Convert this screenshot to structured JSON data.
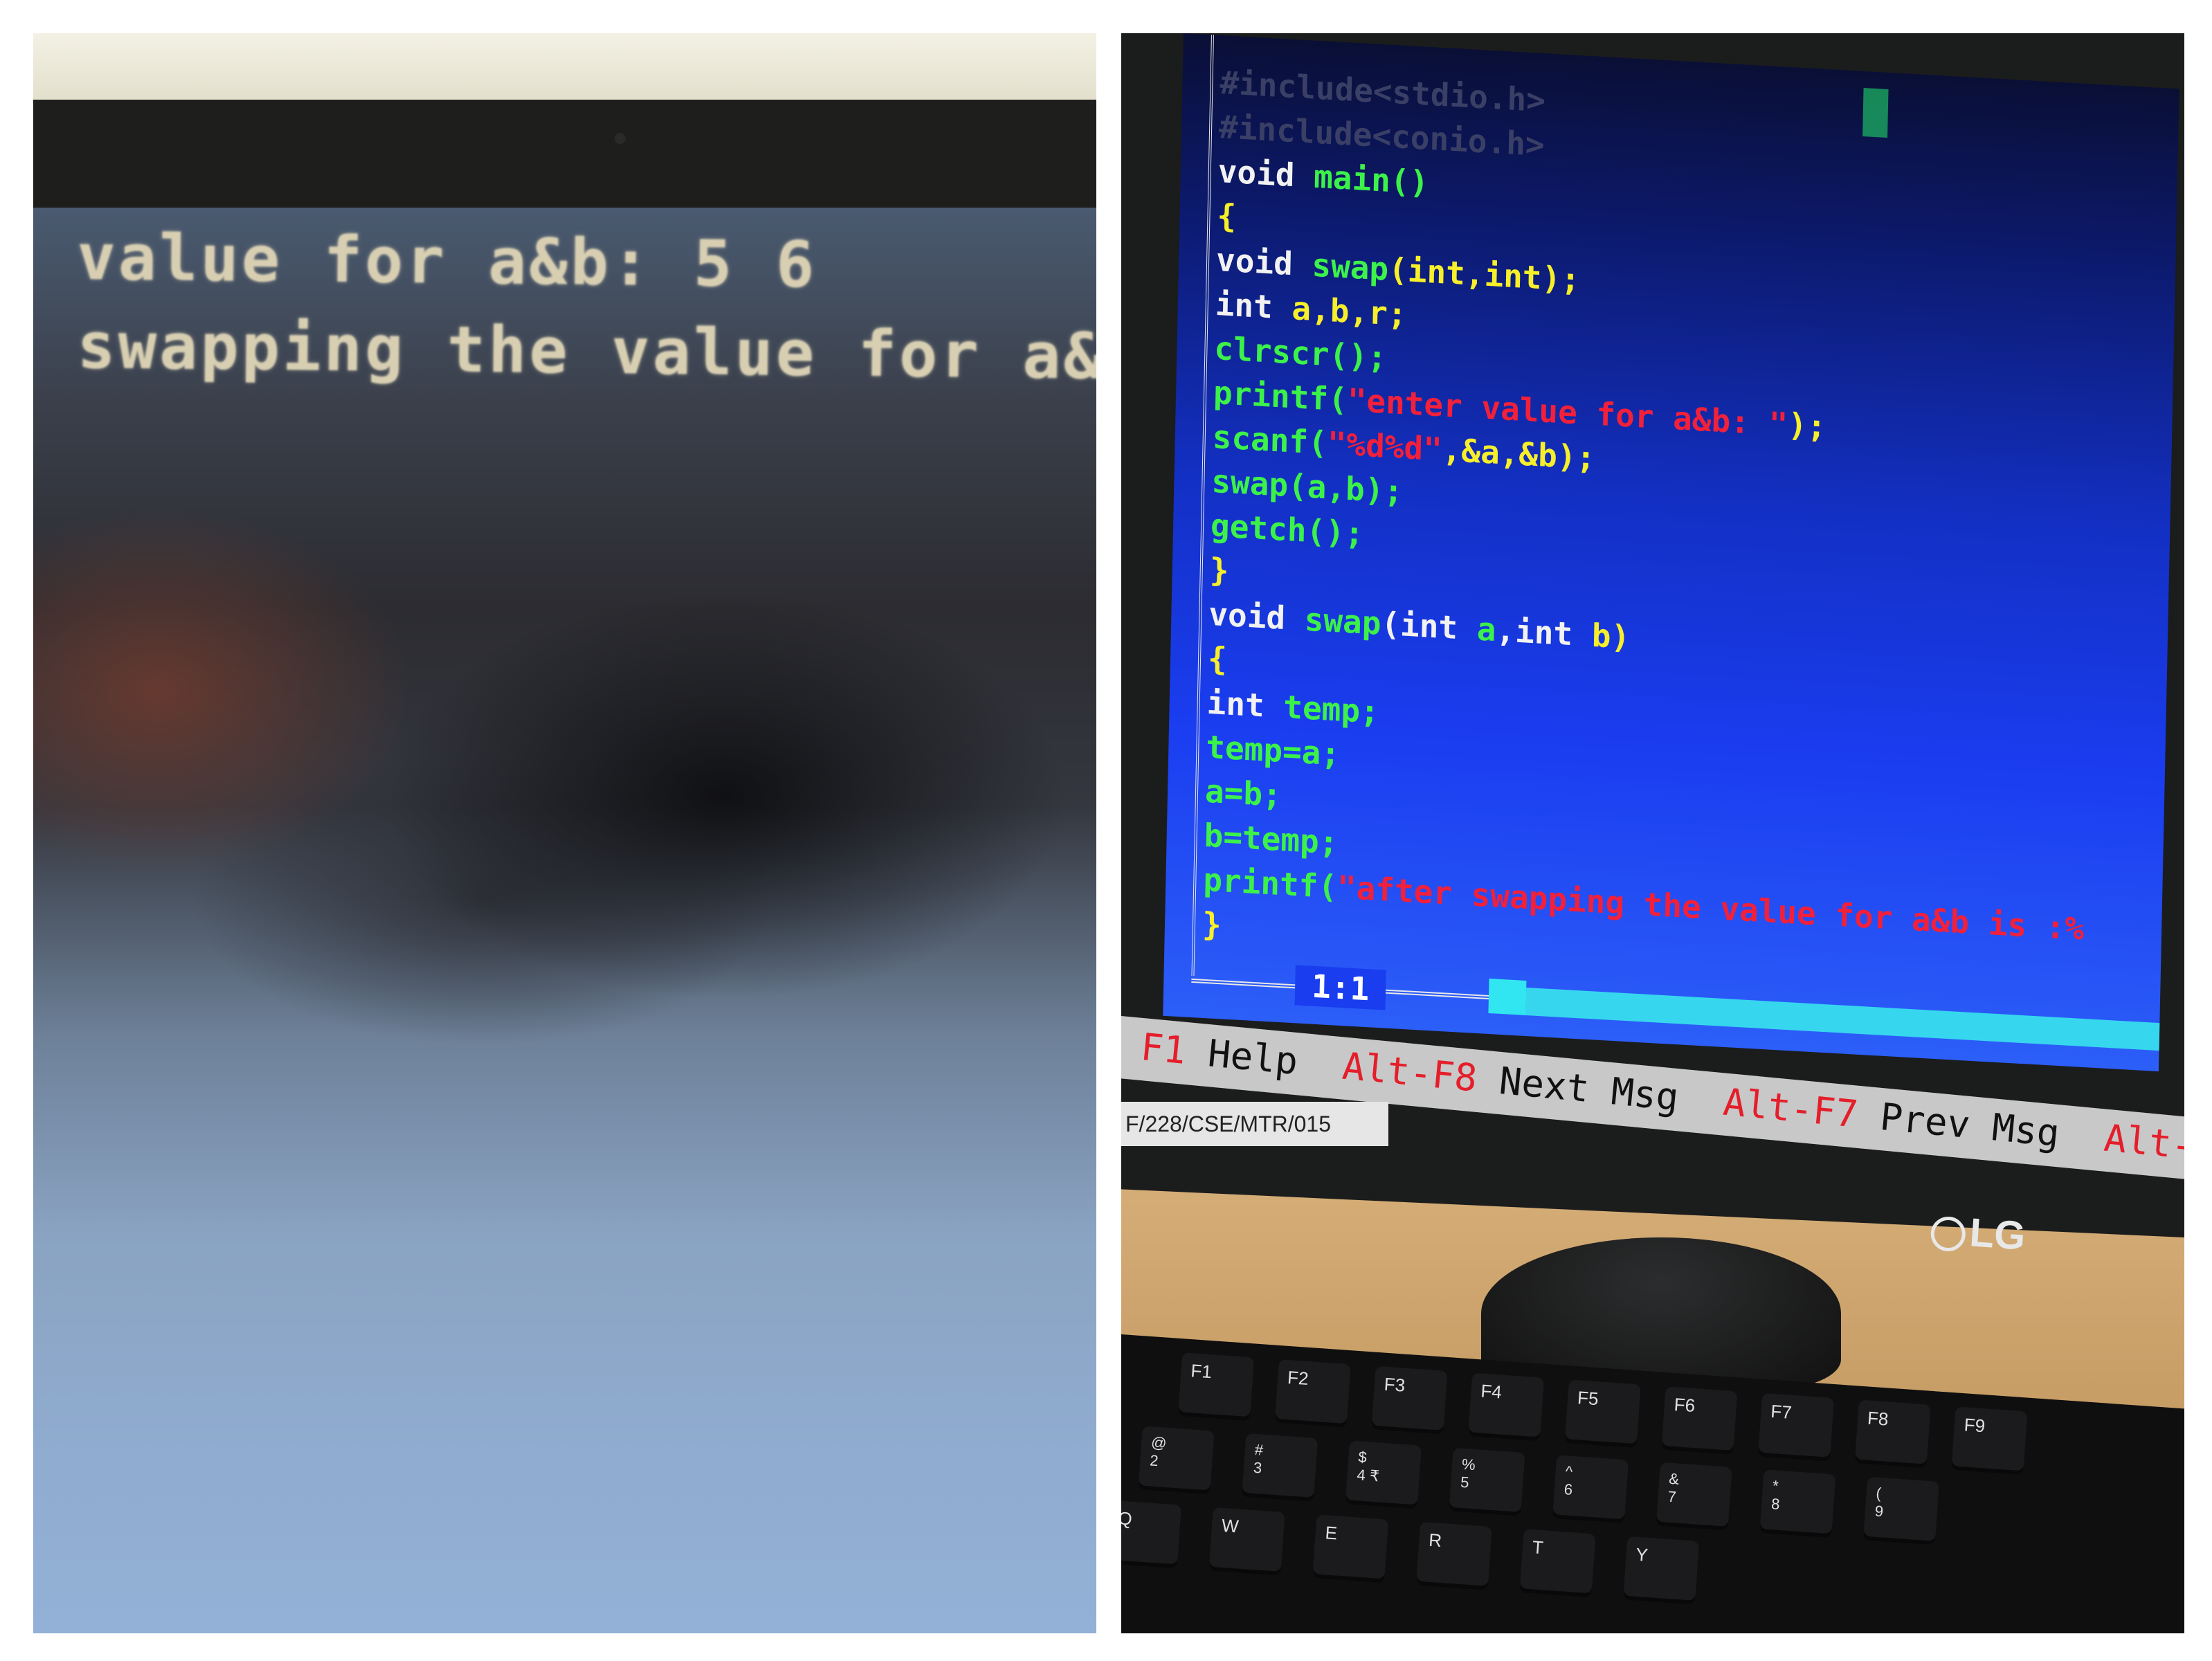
{
  "left_panel": {
    "output_lines": [
      "value for a&b: 5 6",
      "swapping the value for a&"
    ]
  },
  "right_panel": {
    "code_lines": [
      [
        {
          "t": "#include<stdio.h>",
          "c": "dim"
        }
      ],
      [
        {
          "t": "#include<conio.h>",
          "c": "dim"
        }
      ],
      [
        {
          "t": "void ",
          "c": "white"
        },
        {
          "t": "main()",
          "c": "green"
        }
      ],
      [
        {
          "t": "{",
          "c": "yellow"
        }
      ],
      [
        {
          "t": "void ",
          "c": "white"
        },
        {
          "t": "swap",
          "c": "green"
        },
        {
          "t": "(int,int);",
          "c": "yellow"
        }
      ],
      [
        {
          "t": "int ",
          "c": "white"
        },
        {
          "t": "a,b,r;",
          "c": "yellow"
        }
      ],
      [
        {
          "t": "clrscr();",
          "c": "green"
        }
      ],
      [
        {
          "t": "printf(",
          "c": "green"
        },
        {
          "t": "\"enter value for a&b: \"",
          "c": "red"
        },
        {
          "t": ");",
          "c": "yellow"
        }
      ],
      [
        {
          "t": "scanf(",
          "c": "green"
        },
        {
          "t": "\"%d%d\"",
          "c": "red"
        },
        {
          "t": ",&a,&b);",
          "c": "yellow"
        }
      ],
      [
        {
          "t": "swap(a,b);",
          "c": "green"
        }
      ],
      [
        {
          "t": "getch();",
          "c": "green"
        }
      ],
      [
        {
          "t": "}",
          "c": "yellow"
        }
      ],
      [
        {
          "t": "void ",
          "c": "white"
        },
        {
          "t": "swap",
          "c": "green"
        },
        {
          "t": "(int ",
          "c": "white"
        },
        {
          "t": "a",
          "c": "green"
        },
        {
          "t": ",int ",
          "c": "white"
        },
        {
          "t": "b)",
          "c": "yellow"
        }
      ],
      [
        {
          "t": "{",
          "c": "yellow"
        }
      ],
      [
        {
          "t": "int ",
          "c": "white"
        },
        {
          "t": "temp;",
          "c": "green"
        }
      ],
      [
        {
          "t": "temp=a;",
          "c": "green"
        }
      ],
      [
        {
          "t": "a=b;",
          "c": "green"
        }
      ],
      [
        {
          "t": "b=temp;",
          "c": "green"
        }
      ],
      [
        {
          "t": "printf(",
          "c": "green"
        },
        {
          "t": "\"after swapping the value for a&b is :%",
          "c": "red"
        }
      ],
      [
        {
          "t": "}",
          "c": "yellow"
        }
      ]
    ],
    "cursor_position": "1:1",
    "status_bar": [
      {
        "key": "F1",
        "desc": "Help"
      },
      {
        "key": "Alt-F8",
        "desc": "Next Msg"
      },
      {
        "key": "Alt-F7",
        "desc": "Prev Msg"
      },
      {
        "key": "Alt-",
        "desc": ""
      }
    ],
    "asset_tag": "F/228/CSE/MTR/015",
    "monitor_brand": "LG",
    "keyboard_rows": [
      [
        "F1",
        "F2",
        "F3",
        "F4",
        "F5",
        "F6",
        "F7",
        "F8",
        "F9"
      ],
      [
        {
          "top": "@",
          "bot": "2"
        },
        {
          "top": "#",
          "bot": "3"
        },
        {
          "top": "$",
          "bot": "4 ₹"
        },
        {
          "top": "%",
          "bot": "5"
        },
        {
          "top": "^",
          "bot": "6"
        },
        {
          "top": "&",
          "bot": "7"
        },
        {
          "top": "*",
          "bot": "8"
        },
        {
          "top": "(",
          "bot": "9"
        }
      ],
      [
        "Q",
        "W",
        "E",
        "R",
        "T",
        "Y"
      ]
    ]
  },
  "colors": {
    "white": "#f2f2f2",
    "green": "#3cf24a",
    "yellow": "#f6ef2a",
    "red": "#f2203a",
    "dim": "#3a3f66"
  }
}
